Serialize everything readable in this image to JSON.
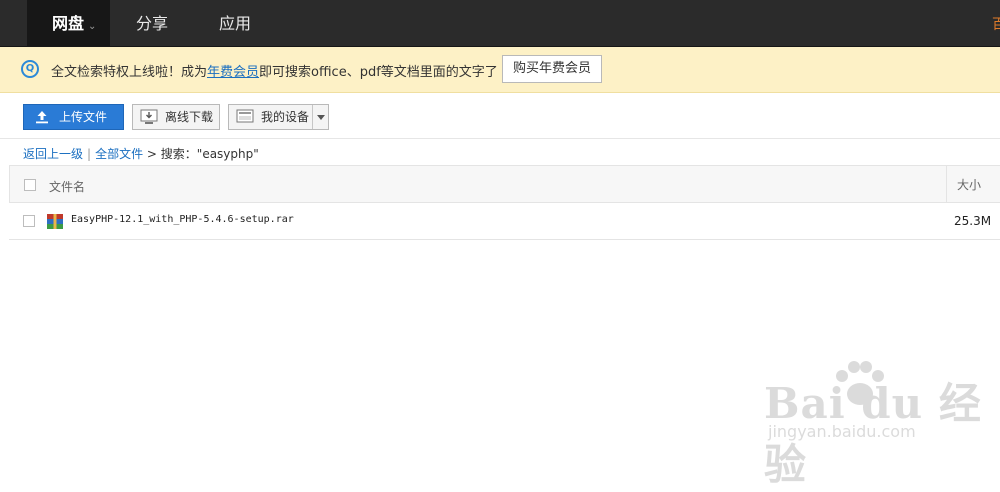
{
  "nav": {
    "items": [
      {
        "label": "网盘",
        "active": true
      },
      {
        "label": "分享"
      },
      {
        "label": "应用"
      }
    ],
    "edge_text": "百"
  },
  "notice": {
    "text_before": "全文检索特权上线啦！成为",
    "link_text": "年费会员",
    "text_after": "即可搜索office、pdf等文档里面的文字了",
    "button_label": "购买年费会员",
    "icon": "search-circle-icon"
  },
  "toolbar": {
    "upload_label": "上传文件",
    "offline_label": "离线下载",
    "device_label": "我的设备",
    "accent": "#2a7bd6"
  },
  "breadcrumb": {
    "back": "返回上一级",
    "sep": "|",
    "all_files": "全部文件",
    "arrow": ">",
    "search_text": "搜索：\"easyphp\""
  },
  "table": {
    "columns": {
      "name": "文件名",
      "size": "大小"
    },
    "rows": [
      {
        "name": "EasyPHP-12.1_with_PHP-5.4.6-setup.rar",
        "size": "25.3M",
        "icon": "rar-archive-icon"
      }
    ]
  },
  "watermark": {
    "logo": "Bai du 经验",
    "url": "jingyan.baidu.com"
  }
}
